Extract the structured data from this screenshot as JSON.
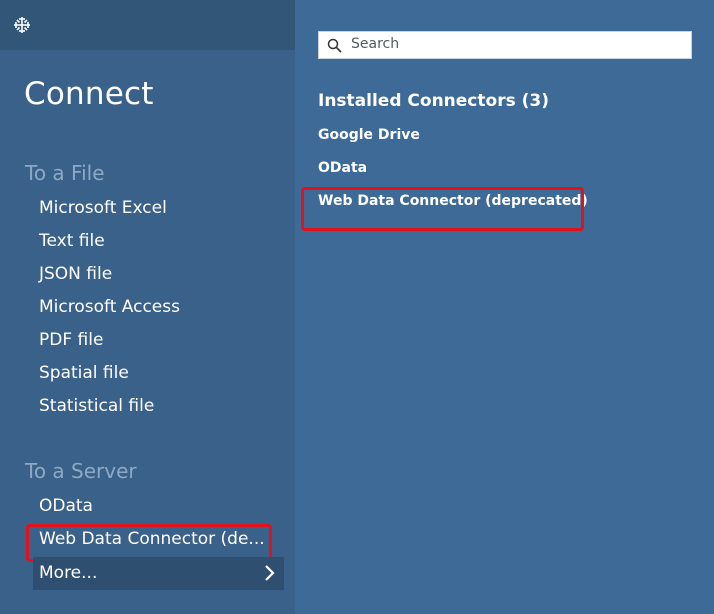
{
  "left_panel": {
    "title": "Connect",
    "to_a_file": {
      "heading": "To a File",
      "items": [
        "Microsoft Excel",
        "Text file",
        "JSON file",
        "Microsoft Access",
        "PDF file",
        "Spatial file",
        "Statistical file"
      ]
    },
    "to_a_server": {
      "heading": "To a Server",
      "items": [
        "OData",
        "Web Data Connector (de..."
      ],
      "more_label": "More..."
    }
  },
  "right_panel": {
    "search": {
      "placeholder": "Search"
    },
    "installed": {
      "title": "Installed Connectors (3)",
      "items": [
        "Google Drive",
        "OData",
        "Web Data Connector (deprecated)"
      ]
    }
  },
  "colors": {
    "left_bg": "#3a6189",
    "right_bg": "#3e6a97",
    "highlight": "#e0121b"
  },
  "icons": [
    "tableau-logo-icon",
    "search-icon",
    "chevron-right-icon"
  ]
}
